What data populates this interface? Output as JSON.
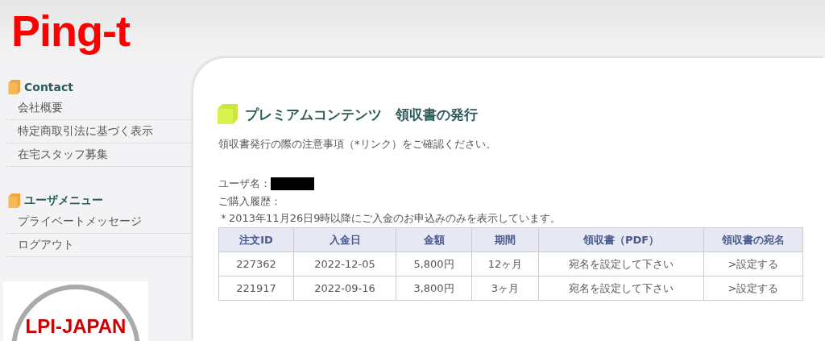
{
  "logo": "Ping-t",
  "sidebar": [
    {
      "heading": "Contact",
      "items": [
        "会社概要",
        "特定商取引法に基づく表示",
        "在宅スタッフ募集"
      ]
    },
    {
      "heading": "ユーザメニュー",
      "items": [
        "プライベートメッセージ",
        "ログアウト"
      ]
    }
  ],
  "badge": {
    "text": "LPI-JAPAN"
  },
  "main": {
    "title": "プレミアムコンテンツ　領収書の発行",
    "notice": "領収書発行の際の注意事項（*リンク）をご確認ください。",
    "username_label": "ユーザ名：",
    "history_label": "ご購入履歴：",
    "note": "＊2013年11月26日9時以降にご入金のお申込みのみを表示しています。"
  },
  "table": {
    "columns": [
      "注文ID",
      "入金日",
      "金額",
      "期間",
      "領収書（PDF）",
      "領収書の宛名"
    ],
    "rows": [
      [
        "227362",
        "2022-12-05",
        "5,800円",
        "12ヶ月",
        "宛名を設定して下さい",
        ">設定する"
      ],
      [
        "221917",
        "2022-09-16",
        "3,800円",
        "3ヶ月",
        "宛名を設定して下さい",
        ">設定する"
      ]
    ]
  }
}
